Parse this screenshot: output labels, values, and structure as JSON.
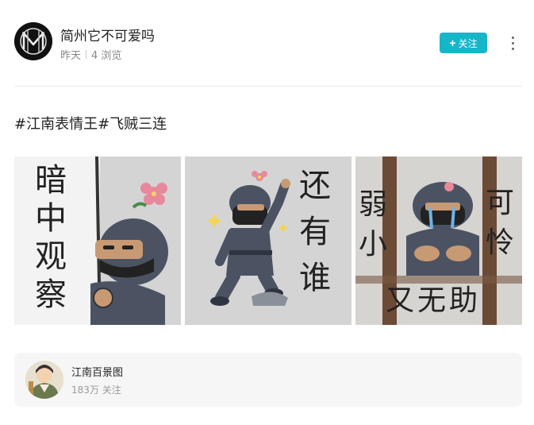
{
  "author": {
    "name": "简州它不可爱吗",
    "time": "昨天",
    "views": "4 浏览"
  },
  "actions": {
    "follow_label": "关注",
    "follow_icon": "plus-icon",
    "more_icon": "more-vertical-icon"
  },
  "post": {
    "text": "#江南表情王#飞贼三连",
    "images": [
      {
        "caption": [
          "暗",
          "中",
          "观",
          "察"
        ]
      },
      {
        "caption": [
          "还",
          "有",
          "谁"
        ]
      },
      {
        "caption_left": [
          "弱",
          "小"
        ],
        "caption_right": [
          "可",
          "怜"
        ],
        "caption_bottom": "又无助"
      }
    ]
  },
  "topic": {
    "name": "江南百景图",
    "followers": "183万 关注"
  },
  "colors": {
    "accent": "#17b5c8",
    "tile_bg": "#d4d4d4",
    "ninja": "#4b5363"
  }
}
